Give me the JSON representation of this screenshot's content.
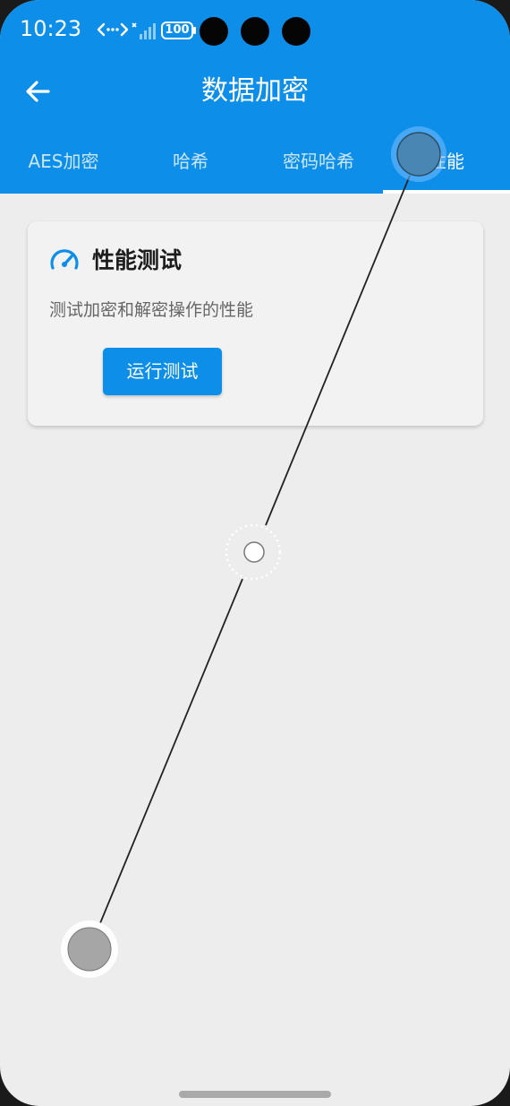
{
  "status_bar": {
    "time": "10:23",
    "battery": "100"
  },
  "app_bar": {
    "title": "数据加密",
    "back_icon": "arrow-back-icon"
  },
  "tabs": [
    {
      "label": "AES加密",
      "active": false
    },
    {
      "label": "哈希",
      "active": false
    },
    {
      "label": "密码哈希",
      "active": false
    },
    {
      "label": "性能",
      "active": true
    }
  ],
  "card": {
    "icon": "speedometer-icon",
    "title": "性能测试",
    "description": "测试加密和解密操作的性能",
    "button_label": "运行测试"
  },
  "colors": {
    "primary": "#0d8ee8",
    "background": "#ededed",
    "card": "#f2f2f2"
  }
}
